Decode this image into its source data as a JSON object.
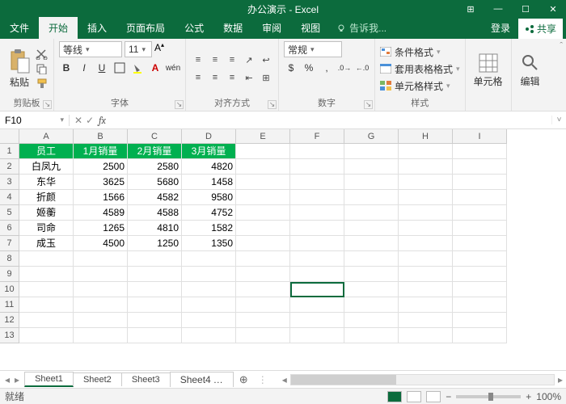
{
  "title": "办公演示 - Excel",
  "win": {
    "ribbonOpts": "⊞",
    "min": "—",
    "max": "☐",
    "close": "✕"
  },
  "tabs": {
    "file": "文件",
    "home": "开始",
    "insert": "插入",
    "layout": "页面布局",
    "formula": "公式",
    "data": "数据",
    "review": "审阅",
    "view": "视图",
    "tell": "告诉我...",
    "login": "登录",
    "share": "共享"
  },
  "ribbon": {
    "clipboard": {
      "label": "剪贴板",
      "paste": "粘贴"
    },
    "font": {
      "label": "字体",
      "name": "等线",
      "size": "11",
      "bold": "B",
      "italic": "I",
      "underline": "U",
      "wen": "wén"
    },
    "align": {
      "label": "对齐方式"
    },
    "number": {
      "label": "数字",
      "format": "常规"
    },
    "styles": {
      "label": "样式",
      "cond": "条件格式",
      "table": "套用表格格式",
      "cell": "单元格样式"
    },
    "cells": {
      "label": "单元格"
    },
    "edit": {
      "label": "编辑"
    }
  },
  "namebox": "F10",
  "fx": "fx",
  "formula": "",
  "cols": [
    "A",
    "B",
    "C",
    "D",
    "E",
    "F",
    "G",
    "H",
    "I"
  ],
  "rowcount": 13,
  "selected": {
    "row": 10,
    "col": "F"
  },
  "chart_data": {
    "type": "table",
    "columns": [
      "员工",
      "1月销量",
      "2月销量",
      "3月销量"
    ],
    "rows": [
      [
        "白凤九",
        2500,
        2580,
        4820
      ],
      [
        "东华",
        3625,
        5680,
        1458
      ],
      [
        "折颜",
        1566,
        4582,
        9580
      ],
      [
        "姬蘅",
        4589,
        4588,
        4752
      ],
      [
        "司命",
        1265,
        4810,
        1582
      ],
      [
        "成玉",
        4500,
        1250,
        1350
      ]
    ]
  },
  "sheets": {
    "s1": "Sheet1",
    "s2": "Sheet2",
    "s3": "Sheet3",
    "s4": "Sheet4",
    "more": "…",
    "add": "⊕"
  },
  "status": {
    "ready": "就绪",
    "zoom": "100%",
    "minus": "−",
    "plus": "+"
  }
}
